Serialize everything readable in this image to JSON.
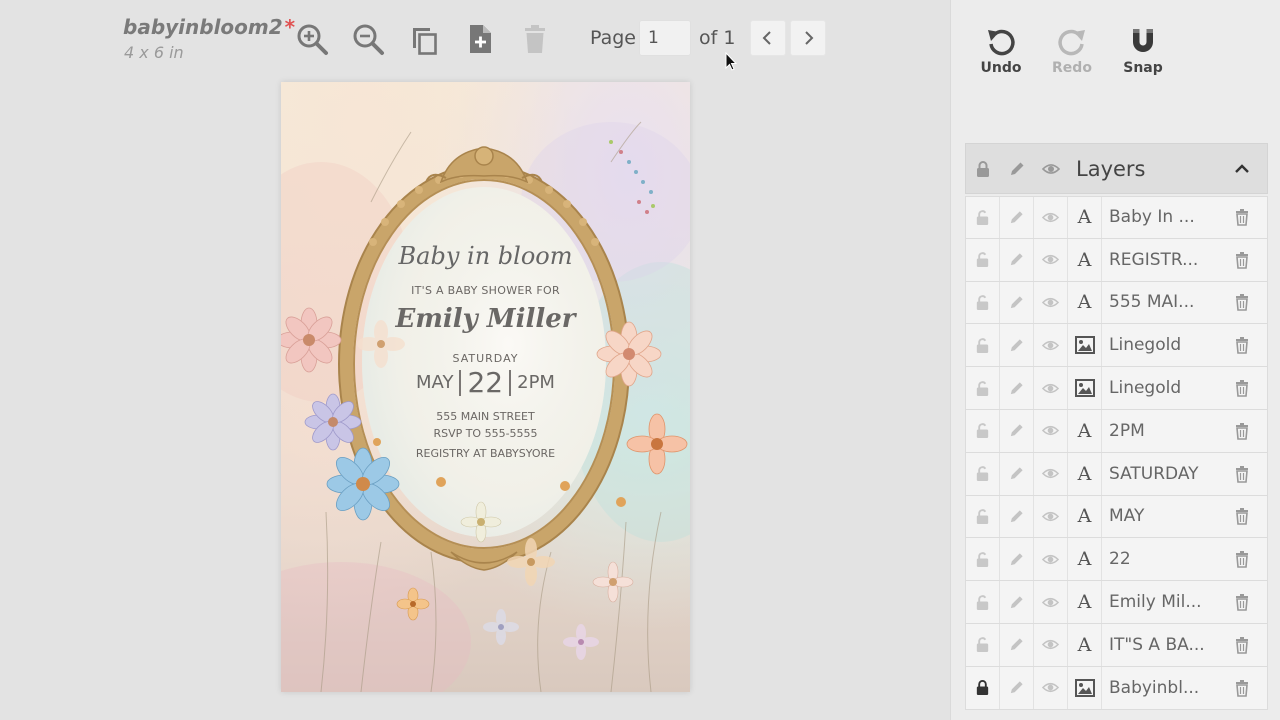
{
  "document": {
    "title": "babyinbloom2",
    "unsaved_marker": "*",
    "size": "4 x 6 in"
  },
  "toolbar": {
    "tools": [
      "zoom-in-icon",
      "zoom-out-icon",
      "duplicate-icon",
      "add-page-icon",
      "delete-icon"
    ]
  },
  "pagination": {
    "label": "Page",
    "current": "1",
    "of_label": "of 1"
  },
  "card": {
    "heading": "Baby in bloom",
    "subheading": "IT'S A BABY SHOWER FOR",
    "name": "Emily Miller",
    "day": "SATURDAY",
    "month": "MAY",
    "date": "22",
    "time": "2PM",
    "address": "555 MAIN STREET",
    "rsvp": "RSVP TO 555-5555",
    "registry": "REGISTRY AT BABYSYORE"
  },
  "history": {
    "undo_label": "Undo",
    "redo_label": "Redo",
    "snap_label": "Snap"
  },
  "layers": {
    "title": "Layers",
    "items": [
      {
        "name": "Baby In ...",
        "type": "text",
        "locked": false
      },
      {
        "name": "REGISTR...",
        "type": "text",
        "locked": false
      },
      {
        "name": "555 MAI...",
        "type": "text",
        "locked": false
      },
      {
        "name": "Linegold",
        "type": "image",
        "locked": false
      },
      {
        "name": "Linegold",
        "type": "image",
        "locked": false
      },
      {
        "name": "2PM",
        "type": "text",
        "locked": false
      },
      {
        "name": "SATURDAY",
        "type": "text",
        "locked": false
      },
      {
        "name": "MAY",
        "type": "text",
        "locked": false
      },
      {
        "name": "22",
        "type": "text",
        "locked": false
      },
      {
        "name": "Emily Mil...",
        "type": "text",
        "locked": false
      },
      {
        "name": "IT\"S A BA...",
        "type": "text",
        "locked": false
      },
      {
        "name": "Babyinbl...",
        "type": "image",
        "locked": true
      }
    ]
  },
  "colors": {
    "accent_unsaved": "#e05252",
    "frame_gold": "#c9a56a",
    "panel_bg": "#ececec"
  }
}
